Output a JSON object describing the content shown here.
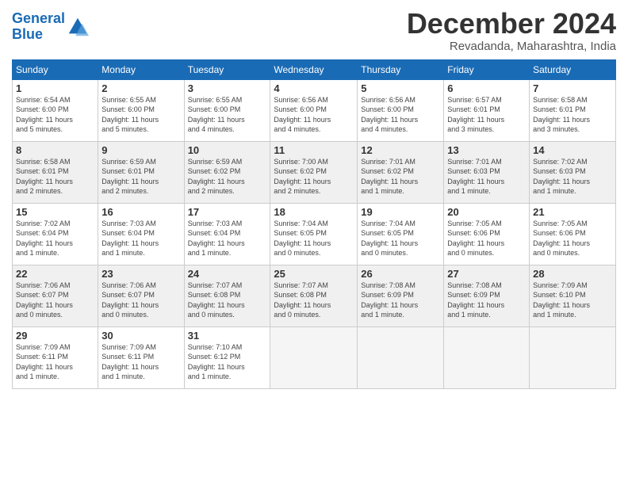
{
  "logo": {
    "line1": "General",
    "line2": "Blue"
  },
  "title": "December 2024",
  "location": "Revadanda, Maharashtra, India",
  "days_of_week": [
    "Sunday",
    "Monday",
    "Tuesday",
    "Wednesday",
    "Thursday",
    "Friday",
    "Saturday"
  ],
  "weeks": [
    [
      {
        "num": "1",
        "info": "Sunrise: 6:54 AM\nSunset: 6:00 PM\nDaylight: 11 hours\nand 5 minutes."
      },
      {
        "num": "2",
        "info": "Sunrise: 6:55 AM\nSunset: 6:00 PM\nDaylight: 11 hours\nand 5 minutes."
      },
      {
        "num": "3",
        "info": "Sunrise: 6:55 AM\nSunset: 6:00 PM\nDaylight: 11 hours\nand 4 minutes."
      },
      {
        "num": "4",
        "info": "Sunrise: 6:56 AM\nSunset: 6:00 PM\nDaylight: 11 hours\nand 4 minutes."
      },
      {
        "num": "5",
        "info": "Sunrise: 6:56 AM\nSunset: 6:00 PM\nDaylight: 11 hours\nand 4 minutes."
      },
      {
        "num": "6",
        "info": "Sunrise: 6:57 AM\nSunset: 6:01 PM\nDaylight: 11 hours\nand 3 minutes."
      },
      {
        "num": "7",
        "info": "Sunrise: 6:58 AM\nSunset: 6:01 PM\nDaylight: 11 hours\nand 3 minutes."
      }
    ],
    [
      {
        "num": "8",
        "info": "Sunrise: 6:58 AM\nSunset: 6:01 PM\nDaylight: 11 hours\nand 2 minutes."
      },
      {
        "num": "9",
        "info": "Sunrise: 6:59 AM\nSunset: 6:01 PM\nDaylight: 11 hours\nand 2 minutes."
      },
      {
        "num": "10",
        "info": "Sunrise: 6:59 AM\nSunset: 6:02 PM\nDaylight: 11 hours\nand 2 minutes."
      },
      {
        "num": "11",
        "info": "Sunrise: 7:00 AM\nSunset: 6:02 PM\nDaylight: 11 hours\nand 2 minutes."
      },
      {
        "num": "12",
        "info": "Sunrise: 7:01 AM\nSunset: 6:02 PM\nDaylight: 11 hours\nand 1 minute."
      },
      {
        "num": "13",
        "info": "Sunrise: 7:01 AM\nSunset: 6:03 PM\nDaylight: 11 hours\nand 1 minute."
      },
      {
        "num": "14",
        "info": "Sunrise: 7:02 AM\nSunset: 6:03 PM\nDaylight: 11 hours\nand 1 minute."
      }
    ],
    [
      {
        "num": "15",
        "info": "Sunrise: 7:02 AM\nSunset: 6:04 PM\nDaylight: 11 hours\nand 1 minute."
      },
      {
        "num": "16",
        "info": "Sunrise: 7:03 AM\nSunset: 6:04 PM\nDaylight: 11 hours\nand 1 minute."
      },
      {
        "num": "17",
        "info": "Sunrise: 7:03 AM\nSunset: 6:04 PM\nDaylight: 11 hours\nand 1 minute."
      },
      {
        "num": "18",
        "info": "Sunrise: 7:04 AM\nSunset: 6:05 PM\nDaylight: 11 hours\nand 0 minutes."
      },
      {
        "num": "19",
        "info": "Sunrise: 7:04 AM\nSunset: 6:05 PM\nDaylight: 11 hours\nand 0 minutes."
      },
      {
        "num": "20",
        "info": "Sunrise: 7:05 AM\nSunset: 6:06 PM\nDaylight: 11 hours\nand 0 minutes."
      },
      {
        "num": "21",
        "info": "Sunrise: 7:05 AM\nSunset: 6:06 PM\nDaylight: 11 hours\nand 0 minutes."
      }
    ],
    [
      {
        "num": "22",
        "info": "Sunrise: 7:06 AM\nSunset: 6:07 PM\nDaylight: 11 hours\nand 0 minutes."
      },
      {
        "num": "23",
        "info": "Sunrise: 7:06 AM\nSunset: 6:07 PM\nDaylight: 11 hours\nand 0 minutes."
      },
      {
        "num": "24",
        "info": "Sunrise: 7:07 AM\nSunset: 6:08 PM\nDaylight: 11 hours\nand 0 minutes."
      },
      {
        "num": "25",
        "info": "Sunrise: 7:07 AM\nSunset: 6:08 PM\nDaylight: 11 hours\nand 0 minutes."
      },
      {
        "num": "26",
        "info": "Sunrise: 7:08 AM\nSunset: 6:09 PM\nDaylight: 11 hours\nand 1 minute."
      },
      {
        "num": "27",
        "info": "Sunrise: 7:08 AM\nSunset: 6:09 PM\nDaylight: 11 hours\nand 1 minute."
      },
      {
        "num": "28",
        "info": "Sunrise: 7:09 AM\nSunset: 6:10 PM\nDaylight: 11 hours\nand 1 minute."
      }
    ],
    [
      {
        "num": "29",
        "info": "Sunrise: 7:09 AM\nSunset: 6:11 PM\nDaylight: 11 hours\nand 1 minute."
      },
      {
        "num": "30",
        "info": "Sunrise: 7:09 AM\nSunset: 6:11 PM\nDaylight: 11 hours\nand 1 minute."
      },
      {
        "num": "31",
        "info": "Sunrise: 7:10 AM\nSunset: 6:12 PM\nDaylight: 11 hours\nand 1 minute."
      },
      {
        "num": "",
        "info": ""
      },
      {
        "num": "",
        "info": ""
      },
      {
        "num": "",
        "info": ""
      },
      {
        "num": "",
        "info": ""
      }
    ]
  ]
}
